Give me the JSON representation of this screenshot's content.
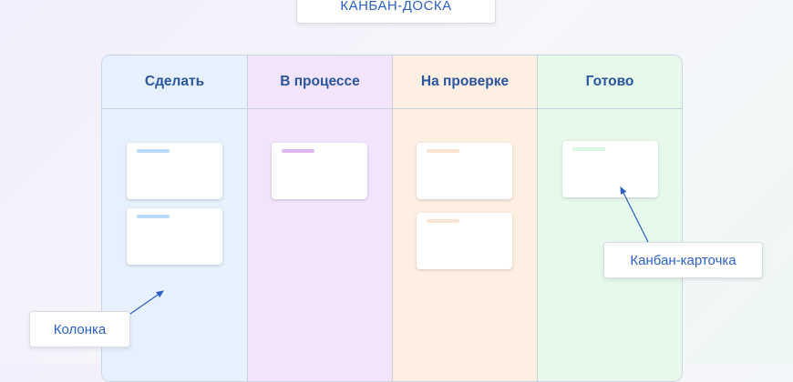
{
  "title": "КАНБАН-ДОСКА",
  "colors": {
    "accent_text": "#2c5fc7",
    "heading_text": "#2c55a0",
    "arrow": "#2c5fc7"
  },
  "columns": [
    {
      "name": "Сделать",
      "bg": "#e6f1fd",
      "stripe": "#b9dbf7",
      "cards": 2
    },
    {
      "name": "В процессе",
      "bg": "#f1e4fb",
      "stripe": "#e0b7f1",
      "cards": 1
    },
    {
      "name": "На проверке",
      "bg": "#fdefe1",
      "stripe": "#f9e2cf",
      "cards": 2
    },
    {
      "name": "Готово",
      "bg": "#e6f9ea",
      "stripe": "#dbf7e1",
      "cards": 1
    }
  ],
  "annotations": {
    "column_label": "Колонка",
    "card_label": "Канбан-карточка"
  }
}
